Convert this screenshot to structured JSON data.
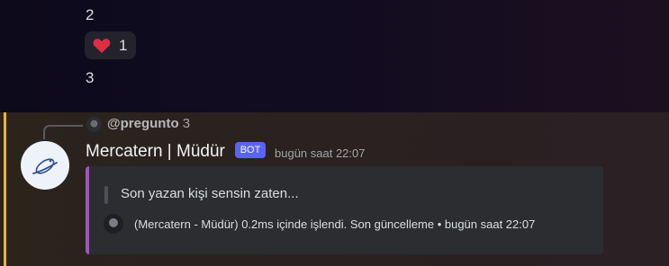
{
  "previous_messages": {
    "line1": "2",
    "line2": "3"
  },
  "reaction": {
    "icon": "heart-icon",
    "count": "1"
  },
  "reply": {
    "mention": "@pregunto",
    "content": "3"
  },
  "message": {
    "author": "Mercatern | Müdür",
    "badge": "BOT",
    "timestamp": "bugün saat 22:07",
    "embed": {
      "accent_color": "#9b59b6",
      "description": "Son yazan kişi sensin zaten...",
      "footer": "(Mercatern - Müdür) 0.2ms içinde işlendi. Son güncelleme • bugün saat 22:07"
    }
  },
  "colors": {
    "highlight_bar": "#f0b232",
    "bot_badge": "#5865f2"
  }
}
